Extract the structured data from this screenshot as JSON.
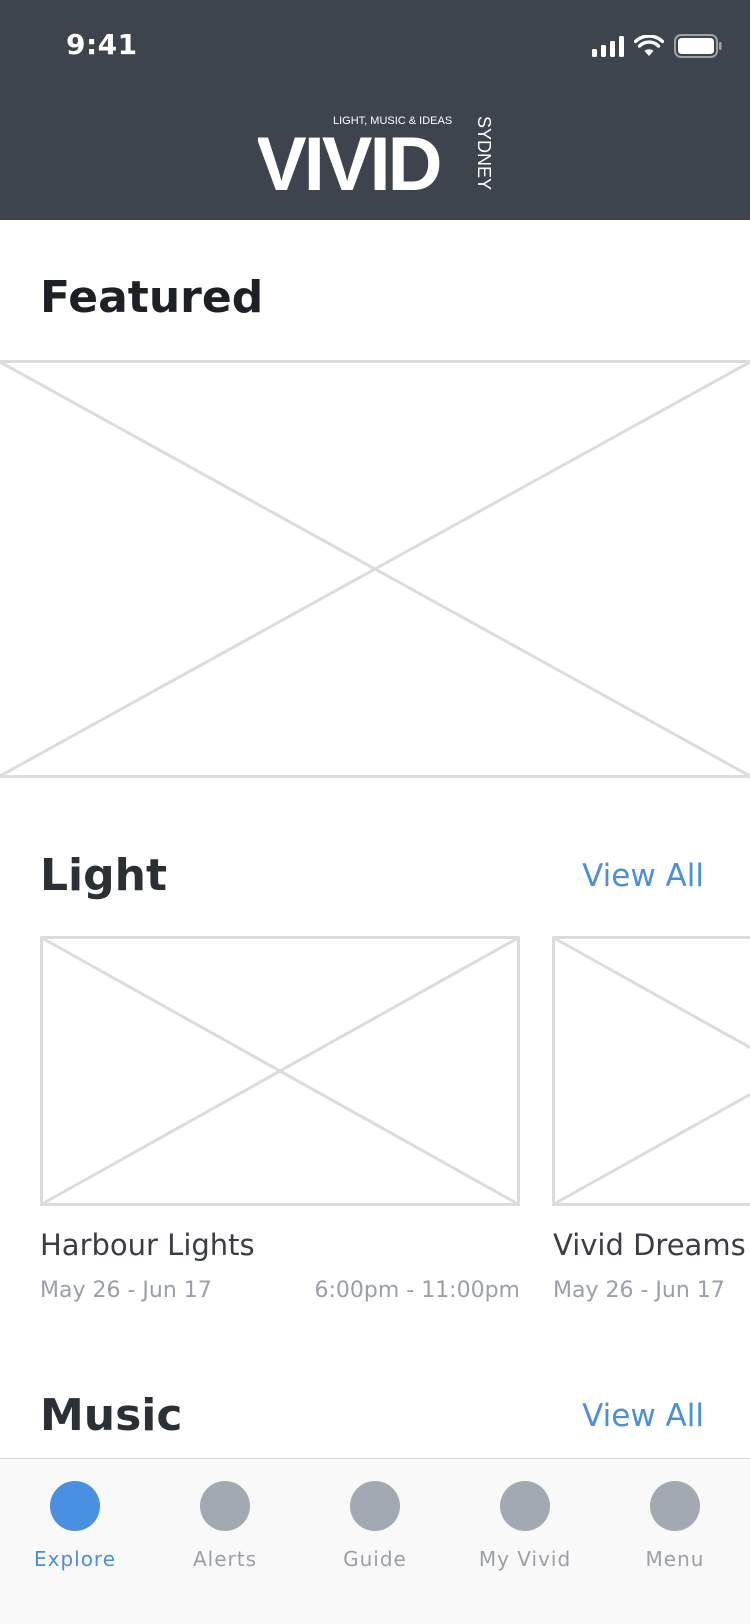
{
  "status_bar": {
    "time": "9:41",
    "icons": [
      "cellular-signal-icon",
      "wifi-icon",
      "battery-icon"
    ]
  },
  "header": {
    "logo_tagline": "LIGHT, MUSIC & IDEAS",
    "logo_word": "VIVID",
    "logo_city": "SYDNEY",
    "background": "#3d444d"
  },
  "featured": {
    "title": "Featured"
  },
  "sections": {
    "light": {
      "title": "Light",
      "view_all": "View All",
      "cards": [
        {
          "title": "Harbour Lights",
          "date": "May 26 - Jun 17",
          "time": "6:00pm - 11:00pm"
        },
        {
          "title": "Vivid Dreams",
          "date": "May 26 - Jun 17"
        }
      ]
    },
    "music": {
      "title": "Music",
      "view_all": "View All"
    }
  },
  "tabbar": {
    "tabs": [
      {
        "label": "Explore",
        "active": true
      },
      {
        "label": "Alerts",
        "active": false
      },
      {
        "label": "Guide",
        "active": false
      },
      {
        "label": "My Vivid",
        "active": false
      },
      {
        "label": "Menu",
        "active": false
      }
    ]
  },
  "colors": {
    "accent": "#4a90e2",
    "placeholder_stroke": "#dadcdf",
    "tab_inactive": "#a2a9b2"
  }
}
